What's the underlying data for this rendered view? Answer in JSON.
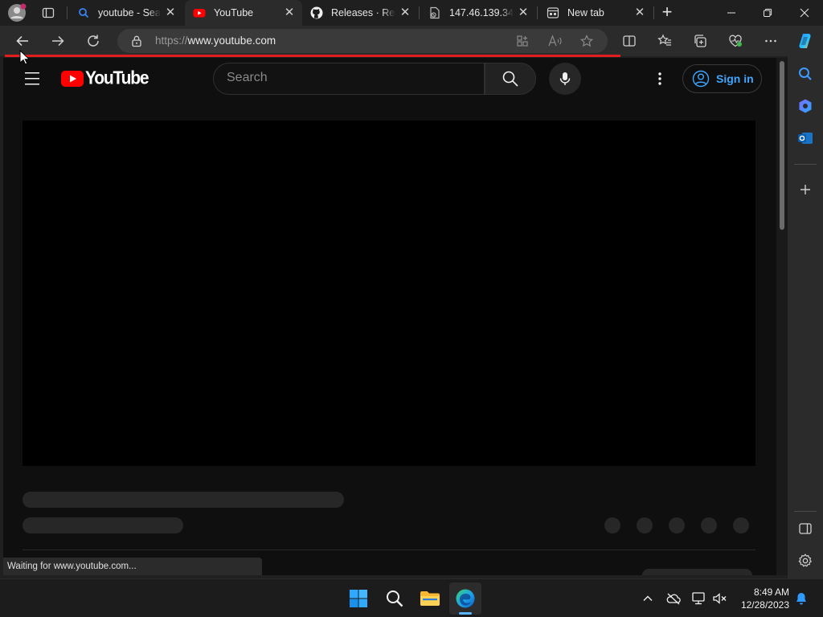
{
  "browser": {
    "tabs": [
      {
        "title": "",
        "icon": "profile-avatar-icon",
        "active": false
      },
      {
        "title": "",
        "icon": "tab-actions-icon",
        "active": false
      },
      {
        "title": "youtube - Search",
        "icon": "search-icon",
        "active": false
      },
      {
        "title": "YouTube",
        "icon": "youtube-icon",
        "active": true
      },
      {
        "title": "Releases · Rectify11",
        "icon": "github-icon",
        "active": false
      },
      {
        "title": "147.46.139.34",
        "icon": "page-error-icon",
        "active": false
      },
      {
        "title": "New tab",
        "icon": "new-tab-page-icon",
        "active": false
      }
    ],
    "new_tab_symbol": "+",
    "url_scheme": "https://",
    "url_host": "www.youtube.com",
    "status_text": "Waiting for www.youtube.com...",
    "loading_color": "#e01e1e"
  },
  "youtube": {
    "logo_text": "YouTube",
    "search_placeholder": "Search",
    "signin_label": "Sign in",
    "brand_red": "#ff0000",
    "link_blue": "#3ea6ff"
  },
  "taskbar": {
    "time": "8:49 AM",
    "date": "12/28/2023",
    "apps": [
      "start-icon",
      "search-icon",
      "file-explorer-icon",
      "edge-icon"
    ]
  }
}
